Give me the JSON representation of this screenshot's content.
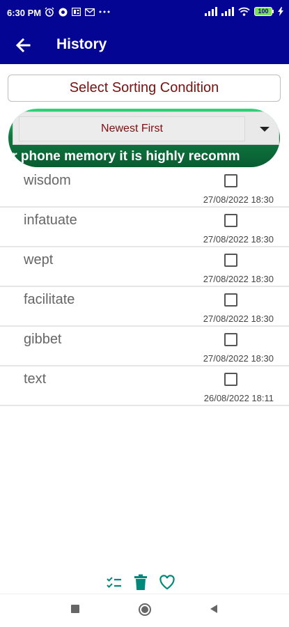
{
  "status_bar": {
    "time": "6:30 PM",
    "battery": "100"
  },
  "app_bar": {
    "title": "History",
    "back_icon": "arrow-back-icon"
  },
  "sort": {
    "button_label": "Select Sorting Condition",
    "selected": "Newest First"
  },
  "banner": {
    "text": "our phone memory it is highly recomm"
  },
  "history": [
    {
      "word": "wisdom",
      "date": "27/08/2022 18:30",
      "checked": false
    },
    {
      "word": "infatuate",
      "date": "27/08/2022 18:30",
      "checked": false
    },
    {
      "word": "wept",
      "date": "27/08/2022 18:30",
      "checked": false
    },
    {
      "word": "facilitate",
      "date": "27/08/2022 18:30",
      "checked": false
    },
    {
      "word": "gibbet",
      "date": "27/08/2022 18:30",
      "checked": false
    },
    {
      "word": "text",
      "date": "26/08/2022 18:11",
      "checked": false
    }
  ],
  "bottom_actions": [
    {
      "icon": "select-all-icon"
    },
    {
      "icon": "delete-icon"
    },
    {
      "icon": "favorite-icon"
    }
  ],
  "colors": {
    "app_bar": "#050594",
    "accent_text": "#7a1010",
    "action_icon": "#00897b"
  }
}
